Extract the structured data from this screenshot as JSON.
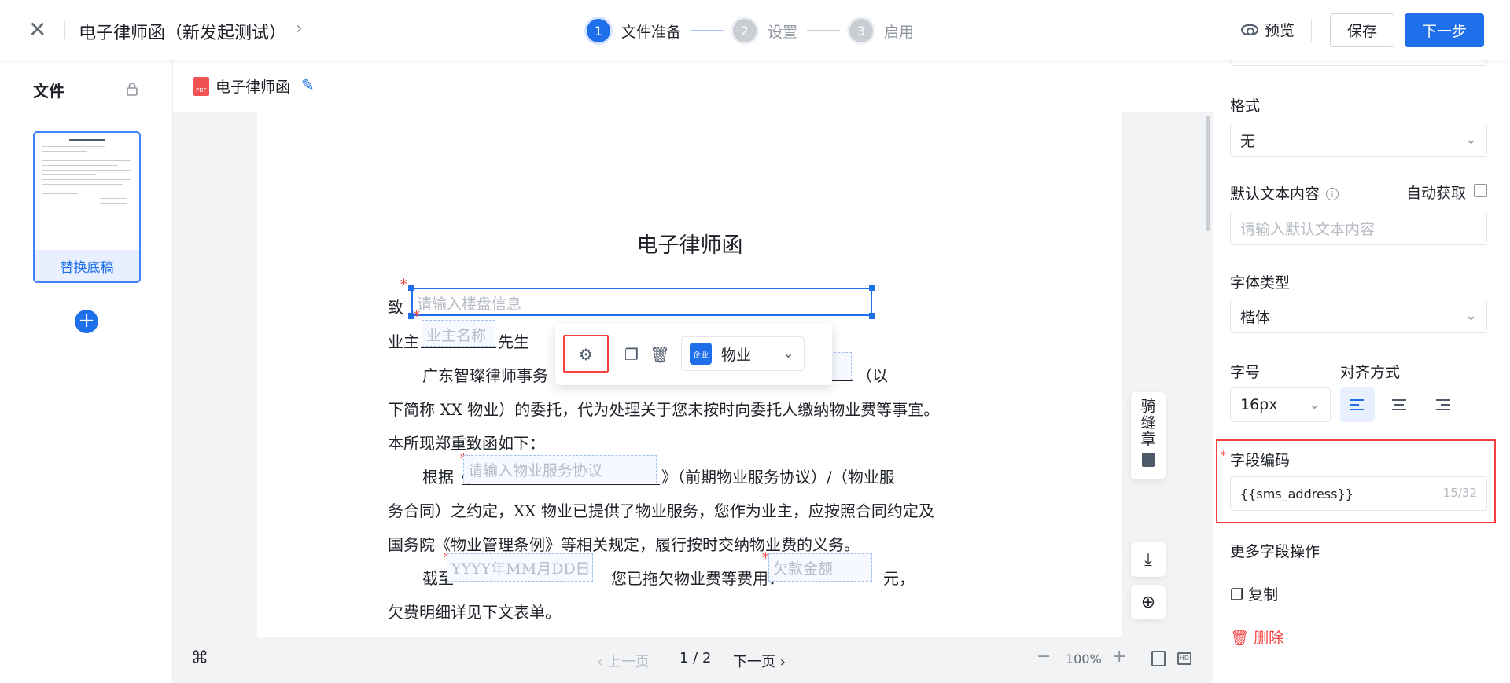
{
  "header": {
    "close_icon": "close-icon",
    "title": "电子律师函（新发起测试）",
    "title_chevron": "›",
    "steps": [
      {
        "num": "1",
        "label": "文件准备"
      },
      {
        "num": "2",
        "label": "设置"
      },
      {
        "num": "3",
        "label": "启用"
      }
    ],
    "preview_label": "预览",
    "save_label": "保存",
    "next_label": "下一步"
  },
  "left": {
    "title": "文件",
    "replace_label": "替换底稿",
    "add_symbol": "+"
  },
  "file": {
    "name": "电子律师函",
    "pdf_tag": "PDF"
  },
  "document": {
    "title": "电子律师函",
    "to_prefix": "致",
    "building_placeholder": "请输入楼盘信息",
    "owner_prefix": "业主",
    "owner_placeholder": "业主名称",
    "owner_suffix": "先生",
    "para1_a": "广东智璨律师事务",
    "para1_b": "（以",
    "para1_c": "下简称 XX 物业）的委托，代为处理关于您未按时向委托人缴纳物业费等事宜。",
    "para1_d": "本所现郑重致函如下：",
    "para2_prefix": "根据《",
    "agreement_placeholder": "请输入物业服务协议",
    "para2_suffix": "》（前期物业服务协议）/（物业服",
    "para2_b": "务合同）之约定，XX 物业已提供了物业服务，您作为业主，应按照合同约定及",
    "para2_c": "国务院《物业管理条例》等相关规定，履行按时交纳物业费的义务。",
    "para3_prefix": "截至",
    "date_placeholder": "YYYY年MM月DD日",
    "para3_mid": "您已拖欠物业费等费用：",
    "amount_placeholder": "欠款金额",
    "para3_suffix": "元，",
    "para3_b": "欠费明细详见下文表单。"
  },
  "popbar": {
    "company_badge": "企业",
    "company_label": "物业"
  },
  "sidetool": {
    "label": "骑缝章"
  },
  "bottom": {
    "cmd_symbol": "⌘",
    "prev_label": "‹ 上一页",
    "page_indicator": "1 / 2",
    "next_label": "下一页 ›",
    "zoom_out": "−",
    "zoom_level": "100%",
    "zoom_in": "+",
    "hd_label": "HD"
  },
  "right": {
    "format_label": "格式",
    "format_value": "无",
    "default_text_label": "默认文本内容",
    "auto_fetch_label": "自动获取",
    "default_text_placeholder": "请输入默认文本内容",
    "font_type_label": "字体类型",
    "font_type_value": "楷体",
    "font_size_label": "字号",
    "font_size_value": "16px",
    "align_label": "对齐方式",
    "field_code_label": "字段编码",
    "field_code_value": "{{sms_address}}",
    "field_code_count": "15/32",
    "more_ops_label": "更多字段操作",
    "copy_label": "复制",
    "delete_label": "删除"
  }
}
